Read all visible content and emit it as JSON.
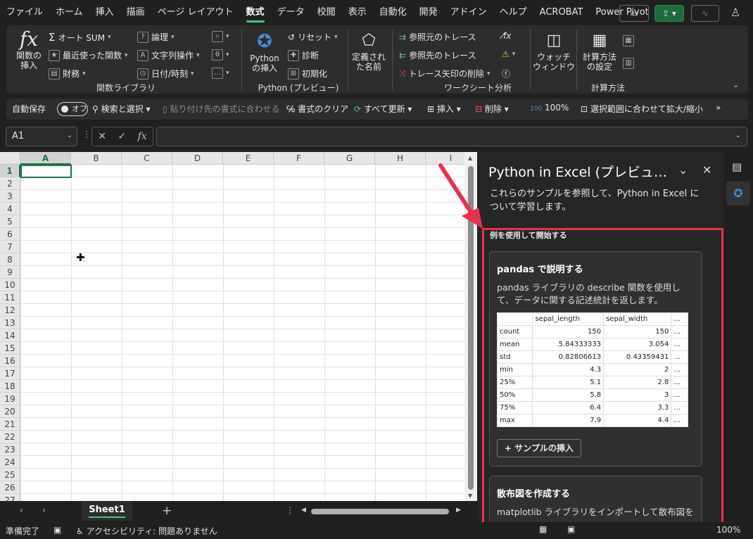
{
  "menubar": {
    "tabs": [
      "ファイル",
      "ホーム",
      "挿入",
      "描画",
      "ページ レイアウト",
      "数式",
      "データ",
      "校閲",
      "表示",
      "自動化",
      "開発",
      "アドイン",
      "ヘルプ",
      "ACROBAT",
      "Power Pivot"
    ],
    "active_tab": "数式"
  },
  "ribbon": {
    "groups": {
      "function_library": "関数ライブラリ",
      "python": "Python (プレビュー)",
      "audit": "ワークシート分析",
      "calc": "計算方法"
    },
    "insert_function": "関数の\n挿入",
    "autosum": "オート SUM",
    "recent": "最近使った関数",
    "financial": "財務",
    "logical": "論理",
    "text": "文字列操作",
    "datetime": "日付/時刻",
    "python_insert": "Python\nの挿入",
    "reset": "リセット",
    "diagnose": "診断",
    "initialize": "初期化",
    "defined_names": "定義され\nた名前",
    "trace_precedents": "参照元のトレース",
    "trace_dependents": "参照先のトレース",
    "remove_arrows": "トレース矢印の削除",
    "watch_window": "ウォッチ\nウィンドウ",
    "calc_options": "計算方法\nの設定"
  },
  "qat": {
    "autosave": "自動保存",
    "toggle": "オフ",
    "search": "検索と選択",
    "paste_format": "貼り付け先の書式に合わせる",
    "clear_format": "書式のクリア",
    "refresh_all": "すべて更新",
    "insert": "挿入",
    "delete": "削除",
    "zoom": "100%",
    "zoom_selection": "選択範囲に合わせて拡大/縮小"
  },
  "formula_bar": {
    "namebox": "A1",
    "fx": "fx"
  },
  "grid": {
    "columns": [
      "A",
      "B",
      "C",
      "D",
      "E",
      "F",
      "G",
      "H",
      "I"
    ],
    "rows": [
      "1",
      "2",
      "3",
      "4",
      "5",
      "6",
      "7",
      "8",
      "9",
      "10",
      "11",
      "12",
      "13",
      "14",
      "15",
      "16",
      "17",
      "18",
      "19",
      "20",
      "21",
      "22",
      "23",
      "24",
      "25",
      "26",
      "27"
    ],
    "selected_cell": "A1"
  },
  "sheets": {
    "active": "Sheet1",
    "add": "+"
  },
  "status": {
    "ready": "準備完了",
    "accessibility": "アクセシビリティ: 問題ありません",
    "zoom": "100%"
  },
  "pane": {
    "title": "Python in Excel (プレビュ…",
    "description": "これらのサンプルを参照して、Python in Excel について学習します。",
    "section": "例を使用して開始する",
    "card1": {
      "title": "pandas で説明する",
      "description": "pandas ライブラリの describe 関数を使用して、データに関する記述統計を返します。",
      "table": {
        "headers": [
          "",
          "sepal_length",
          "sepal_width",
          "..."
        ],
        "rows": [
          [
            "count",
            "150",
            "150",
            "..."
          ],
          [
            "mean",
            "5.84333333",
            "3.054",
            "..."
          ],
          [
            "std",
            "0.82806613",
            "0.43359431",
            "..."
          ],
          [
            "min",
            "4.3",
            "2",
            "..."
          ],
          [
            "25%",
            "5.1",
            "2.8",
            "..."
          ],
          [
            "50%",
            "5.8",
            "3",
            "..."
          ],
          [
            "75%",
            "6.4",
            "3.3",
            "..."
          ],
          [
            "max",
            "7.9",
            "4.4",
            "..."
          ]
        ]
      },
      "button": "+ サンプルの挿入"
    },
    "card2": {
      "title": "散布図を作成する",
      "description": "matplotlib ライブラリをインポートして散布図を作成"
    }
  },
  "colors": {
    "accent_green": "#217346",
    "highlight_red": "#e8324a",
    "tab_underline": "#4ec27a"
  }
}
